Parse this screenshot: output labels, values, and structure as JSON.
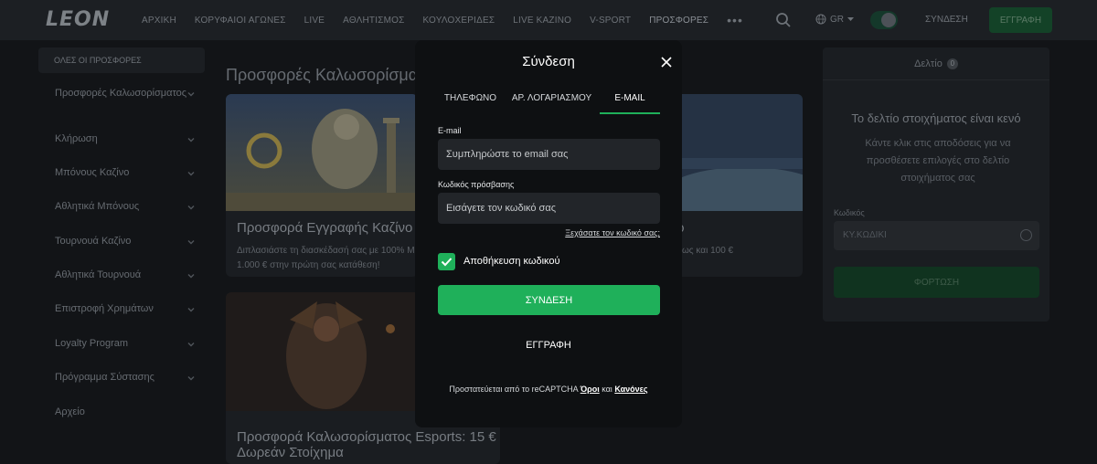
{
  "header": {
    "logo": "LEON",
    "nav": [
      "ΑΡΧΙΚΗ",
      "ΚΟΡΥΦΑΙΟΙ ΑΓΩΝΕΣ",
      "LIVE",
      "ΑΘΛΗΤΙΣΜΟΣ",
      "ΚΟΥΛΟΧΕΡΙΔΕΣ",
      "LIVE ΚΑΖΙΝΟ",
      "V-SPORT",
      "ΠΡΟΣΦΟΡΕΣ"
    ],
    "more": "•••",
    "lang": "GR",
    "login": "ΣΥΝΔΕΣΗ",
    "register": "ΕΓΓΡΑΦΗ"
  },
  "sidebar": {
    "all_label": "ΟΛΕΣ ΟΙ ΠΡΟΣΦΟΡΕΣ",
    "items": [
      "Προσφορές Καλωσορίσματος",
      "Κλήρωση",
      "Μπόνους Καζίνο",
      "Αθλητικά Μπόνους",
      "Τουρνουά Καζίνο",
      "Αθλητικά Τουρνουά",
      "Επιστροφή Χρημάτων",
      "Loyalty Program",
      "Πρόγραμμα Σύστασης",
      "Αρχείο"
    ]
  },
  "main": {
    "title": "Προσφορές Καλωσορίσματος",
    "cards": [
      {
        "title": "Προσφορά Εγγραφής Καζίνο",
        "desc_line1": "Διπλασιάστε τη διασκέδασή σας με 100% Μ",
        "desc_line2": "1.000 € στην πρώτη σας κατάθεση!"
      },
      {
        "title": "ρ",
        "desc_line1": "ως και 100 €"
      },
      {
        "title_line1": "Προσφορά Καλωσορίσματος Esports: 15 €",
        "title_line2": "Δωρεάν Στοίχημα"
      }
    ]
  },
  "betslip": {
    "tab": "Δελτίο",
    "count": "0",
    "empty": "Το δελτίο στοιχήματος είναι κενό",
    "hint": "Κάντε κλικ στις αποδόσεις για να προσθέσετε επιλογές στο δελτίο στοιχήματος σας",
    "code_label": "Κωδικός",
    "code_placeholder": "ΚΥ.ΚΩΔΙΚΙ",
    "load": "ΦΟΡΤΩΣΗ"
  },
  "modal": {
    "title": "Σύνδεση",
    "tabs": [
      "ΤΗΛΕΦΩΝΟ",
      "ΑΡ. ΛΟΓΑΡΙΑΣΜΟΥ",
      "E-MAIL"
    ],
    "active_tab": 2,
    "email_label": "E-mail",
    "email_placeholder": "Συμπληρώστε το email σας",
    "password_label": "Κωδικός πρόσβασης",
    "password_placeholder": "Εισάγετε τον κωδικό σας",
    "forgot": "Ξεχάσατε τον κωδικό σας;",
    "remember_label": "Αποθήκευση κωδικού",
    "remember_checked": true,
    "submit": "ΣΥΝΔΕΣΗ",
    "register": "ΕΓΓΡΑΦΗ",
    "captcha_prefix": "Προστατεύεται από το reCAPTCHA",
    "captcha_terms": "Όροι",
    "captcha_and": "και",
    "captcha_rules": "Κανόνες"
  },
  "colors": {
    "accent": "#1fb05a",
    "background": "#121417",
    "modal": "#0e1012",
    "input": "#222529"
  }
}
